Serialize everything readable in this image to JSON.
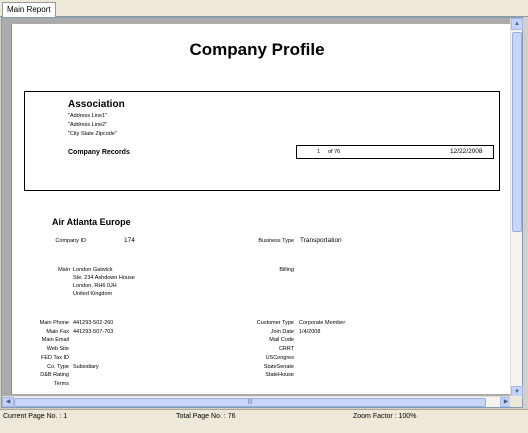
{
  "tabs": [
    "Main Report"
  ],
  "report": {
    "title": "Company Profile",
    "association": {
      "name": "Association",
      "address1": "\"Address Line1\"",
      "address2": "\"Address Line2\"",
      "city_state_zip": "\"City State Zipcode\"",
      "records_label": "Company Records",
      "record_index": "1",
      "record_of": "of 76",
      "date": "12/22/2008"
    },
    "company": {
      "name": "Air Atlanta Europe",
      "company_id_label": "Company ID",
      "company_id": "174",
      "business_type_label": "Business Type",
      "business_type": "Transportation",
      "main_label": "Main",
      "main_address": [
        "London Gatwick",
        "Ste. 234 Ashdown House",
        "London,  RH6 0JH",
        "United Kingdom"
      ],
      "billing_label": "Billing",
      "left_fields": [
        {
          "label": "Main Phone",
          "value": "441293-502-260"
        },
        {
          "label": "Main Fax",
          "value": "441293-507-703"
        },
        {
          "label": "Main Email",
          "value": ""
        },
        {
          "label": "Web Site",
          "value": ""
        },
        {
          "label": "FED Tax ID",
          "value": ""
        },
        {
          "label": "Co. Type",
          "value": "Subsidiary"
        },
        {
          "label": "D&B Rating",
          "value": ""
        },
        {
          "label": "Terms",
          "value": ""
        }
      ],
      "right_fields": [
        {
          "label": "Customer Type",
          "value": "Corporate Member"
        },
        {
          "label": "Join Date",
          "value": "1/4/2008"
        },
        {
          "label": "Mail Code",
          "value": ""
        },
        {
          "label": "CRRT",
          "value": ""
        },
        {
          "label": "USCongres",
          "value": ""
        },
        {
          "label": "StateSenate",
          "value": ""
        },
        {
          "label": "StateHouse",
          "value": ""
        }
      ]
    }
  },
  "status": {
    "current_page": "Current Page No. : 1",
    "total_page": "Total Page No. : 76",
    "zoom": "Zoom Factor : 100%"
  },
  "icons": {
    "scroll_up": "▲",
    "scroll_down": "▼",
    "scroll_left": "◀",
    "scroll_right": "▶",
    "thumb_grip": "|||"
  }
}
